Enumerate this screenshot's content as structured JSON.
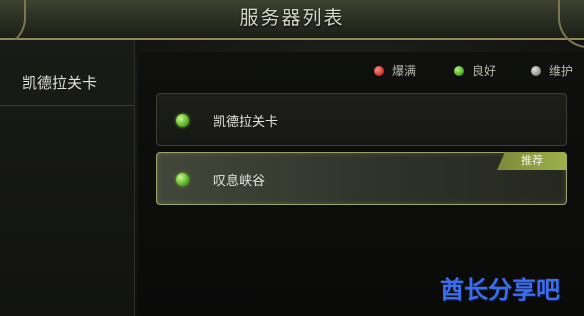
{
  "window": {
    "title": "服务器列表"
  },
  "sidebar": {
    "items": [
      {
        "label": "凯德拉关卡"
      }
    ]
  },
  "legend": [
    {
      "label": "爆满",
      "color": "#c8302a",
      "icon": "red-dot-icon"
    },
    {
      "label": "良好",
      "color": "#49a21c",
      "icon": "green-dot-icon"
    },
    {
      "label": "维护",
      "color": "#8a8a8a",
      "icon": "gray-dot-icon"
    }
  ],
  "servers": [
    {
      "name": "凯德拉关卡",
      "status": "良好",
      "selected": false
    },
    {
      "name": "叹息峡谷",
      "status": "良好",
      "selected": true,
      "badge": "推荐"
    }
  ],
  "watermark": "酋长分享吧"
}
